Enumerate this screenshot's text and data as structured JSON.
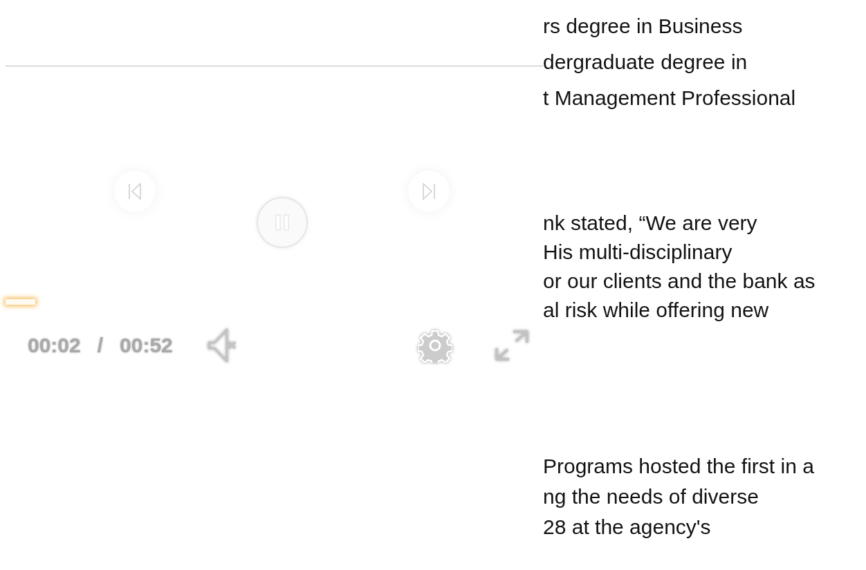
{
  "player": {
    "playing": true,
    "muted": true,
    "progress": {
      "level": 0.055
    },
    "current_time": "00:02",
    "separator": "/",
    "duration": "00:52"
  },
  "article": {
    "paragraphs": [
      {
        "lines": [
          "rs degree in Business",
          "dergraduate degree in",
          "t Management Professional"
        ]
      },
      {
        "lines": [
          "nk stated, “We are very",
          "His multi-disciplinary",
          "or our clients and the bank as",
          "al risk while offering new"
        ]
      },
      {
        "lines": [
          "Programs hosted the first in a",
          "ng the needs of diverse",
          "28 at the agency's"
        ]
      }
    ]
  }
}
